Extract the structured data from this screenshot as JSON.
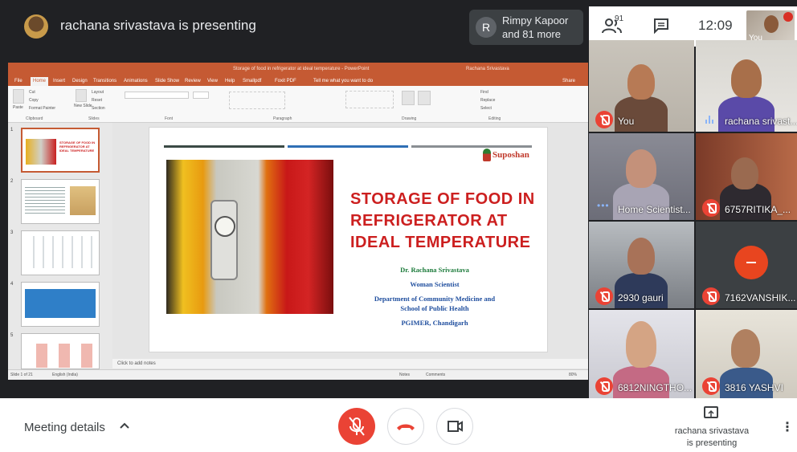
{
  "topbar": {
    "presenting_text": "rachana srivastava is presenting",
    "pinned": {
      "initial": "R",
      "name_line1": "Rimpy Kapoor",
      "name_line2": "and 81 more"
    },
    "participant_count": "91",
    "clock": "12:09",
    "self_label": "You"
  },
  "ppt": {
    "window_title": "Storage of food in refrigerator at ideal temperature - PowerPoint",
    "user_name": "Rachana Srivastava",
    "menu": [
      "File",
      "Home",
      "Insert",
      "Design",
      "Transitions",
      "Animations",
      "Slide Show",
      "Review",
      "View",
      "Help",
      "Smallpdf",
      "Foxit PDF",
      "Tell me what you want to do",
      "Share"
    ],
    "ribbon_groups": [
      "Clipboard",
      "Slides",
      "Font",
      "Paragraph",
      "Drawing",
      "Editing"
    ],
    "ribbon_labels": {
      "cut": "Cut",
      "copy": "Copy",
      "format_painter": "Format Painter",
      "paste": "Paste",
      "new_slide": "New Slide",
      "layout": "Layout",
      "reset": "Reset",
      "section": "Section",
      "find": "Find",
      "replace": "Replace",
      "select": "Select"
    },
    "slide_numbers": [
      "1",
      "2",
      "3",
      "4",
      "5"
    ],
    "thumb1_title": "STORAGE OF FOOD IN REFRIGERATOR AT IDEAL TEMPERATURE",
    "notes_placeholder": "Click to add notes",
    "status": {
      "slide_of": "Slide 1 of 21",
      "language": "English (India)",
      "notes": "Notes",
      "comments": "Comments",
      "zoom": "80%"
    }
  },
  "slide": {
    "logo_text": "Suposhan",
    "title_line1": "STORAGE OF FOOD IN",
    "title_line2": "REFRIGERATOR AT",
    "title_line3": "IDEAL TEMPERATURE",
    "author": "Dr. Rachana Srivastava",
    "role": "Woman Scientist",
    "dept_line1": "Department of Community Medicine and",
    "dept_line2": "School of Public Health",
    "institute": "PGIMER, Chandigarh",
    "colors": {
      "bar1": "#3b4a45",
      "bar2": "#2f6fb5",
      "bar3": "#8a8f93",
      "title": "#cc1f1f"
    }
  },
  "participants": [
    {
      "name": "You",
      "muted": true
    },
    {
      "name": "rachana srivast...",
      "muted": false,
      "speaking": true
    },
    {
      "name": "Home Scientist...",
      "muted": false
    },
    {
      "name": "6757RITIKA_...",
      "muted": true
    },
    {
      "name": "2930 gauri",
      "muted": true
    },
    {
      "name": "7162VANSHIK...",
      "muted": true
    },
    {
      "name": "6812NINGTHO...",
      "muted": true
    },
    {
      "name": "3816 YASHVI",
      "muted": true
    }
  ],
  "bottombar": {
    "meeting_details": "Meeting details",
    "presenting_line1": "rachana srivastava",
    "presenting_line2": "is presenting"
  }
}
